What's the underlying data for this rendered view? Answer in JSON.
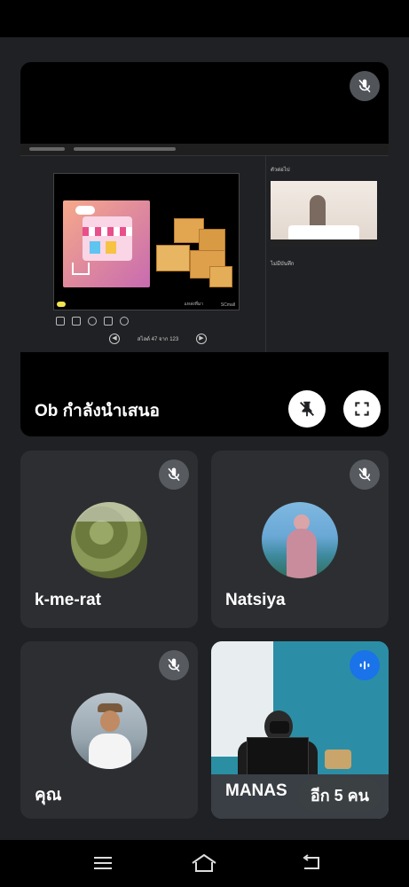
{
  "presenter": {
    "name": "Ob กำลังนำเสนอ",
    "shared_screen": {
      "slide_info": "สไลด์ 47 จาก 123",
      "notes_title": "ตัวต่อไป",
      "notes_caption": "ไม่มีบันทึก",
      "slide_footer_left": "แหล่งที่มา",
      "slide_footer_right": "SCmall"
    }
  },
  "participants": [
    {
      "name": "k-me-rat",
      "mic_muted": true
    },
    {
      "name": "Natsiya",
      "mic_muted": true
    },
    {
      "name": "คุณ",
      "mic_muted": true
    },
    {
      "name": "MANAS",
      "mic_muted": false,
      "speaking": true
    }
  ],
  "more_people_label": "อีก 5 คน",
  "colors": {
    "background": "#202124",
    "tile": "#2d2e31",
    "speaking_indicator": "#1a73e8"
  }
}
